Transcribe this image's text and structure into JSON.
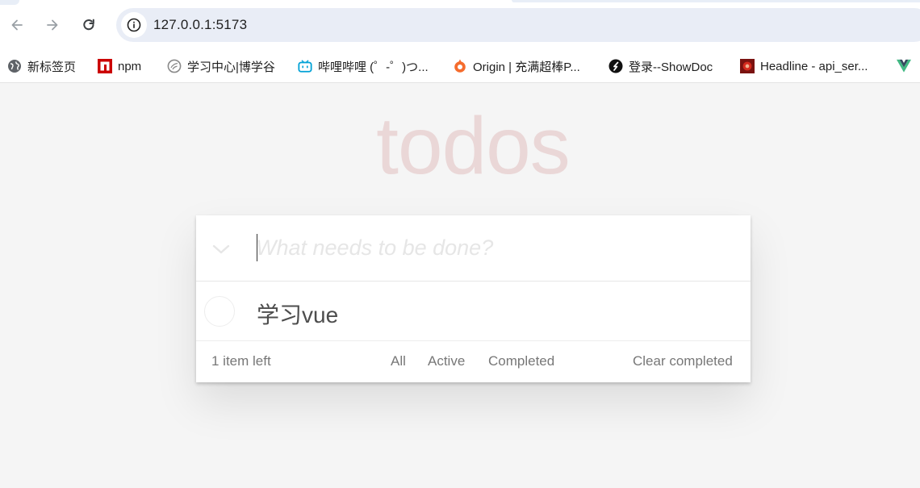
{
  "browser": {
    "url": "127.0.0.1:5173",
    "bookmarks": [
      {
        "icon": "globe-icon",
        "label": "新标签页"
      },
      {
        "icon": "npm-icon",
        "label": "npm"
      },
      {
        "icon": "boxuegu-icon",
        "label": "学习中心|博学谷"
      },
      {
        "icon": "bilibili-icon",
        "label": "哔哩哔哩 (゜-゜)つ..."
      },
      {
        "icon": "origin-icon",
        "label": "Origin | 充满超棒P..."
      },
      {
        "icon": "showdoc-icon",
        "label": "登录--ShowDoc"
      },
      {
        "icon": "headline-icon",
        "label": "Headline - api_ser..."
      },
      {
        "icon": "vue-icon",
        "label": ""
      }
    ]
  },
  "app": {
    "title": "todos",
    "new_todo_placeholder": "What needs to be done?",
    "new_todo_value": "",
    "todos": [
      {
        "title": "学习vue",
        "completed": false
      }
    ],
    "footer": {
      "count_text": "1 item left",
      "filters": [
        "All",
        "Active",
        "Completed"
      ],
      "selected_filter": "All",
      "clear_label": "Clear completed"
    }
  },
  "colors": {
    "title": "#af2f2f",
    "text": "#4d4d4d",
    "footer_text": "#777777",
    "page_bg": "#f5f5f5"
  }
}
